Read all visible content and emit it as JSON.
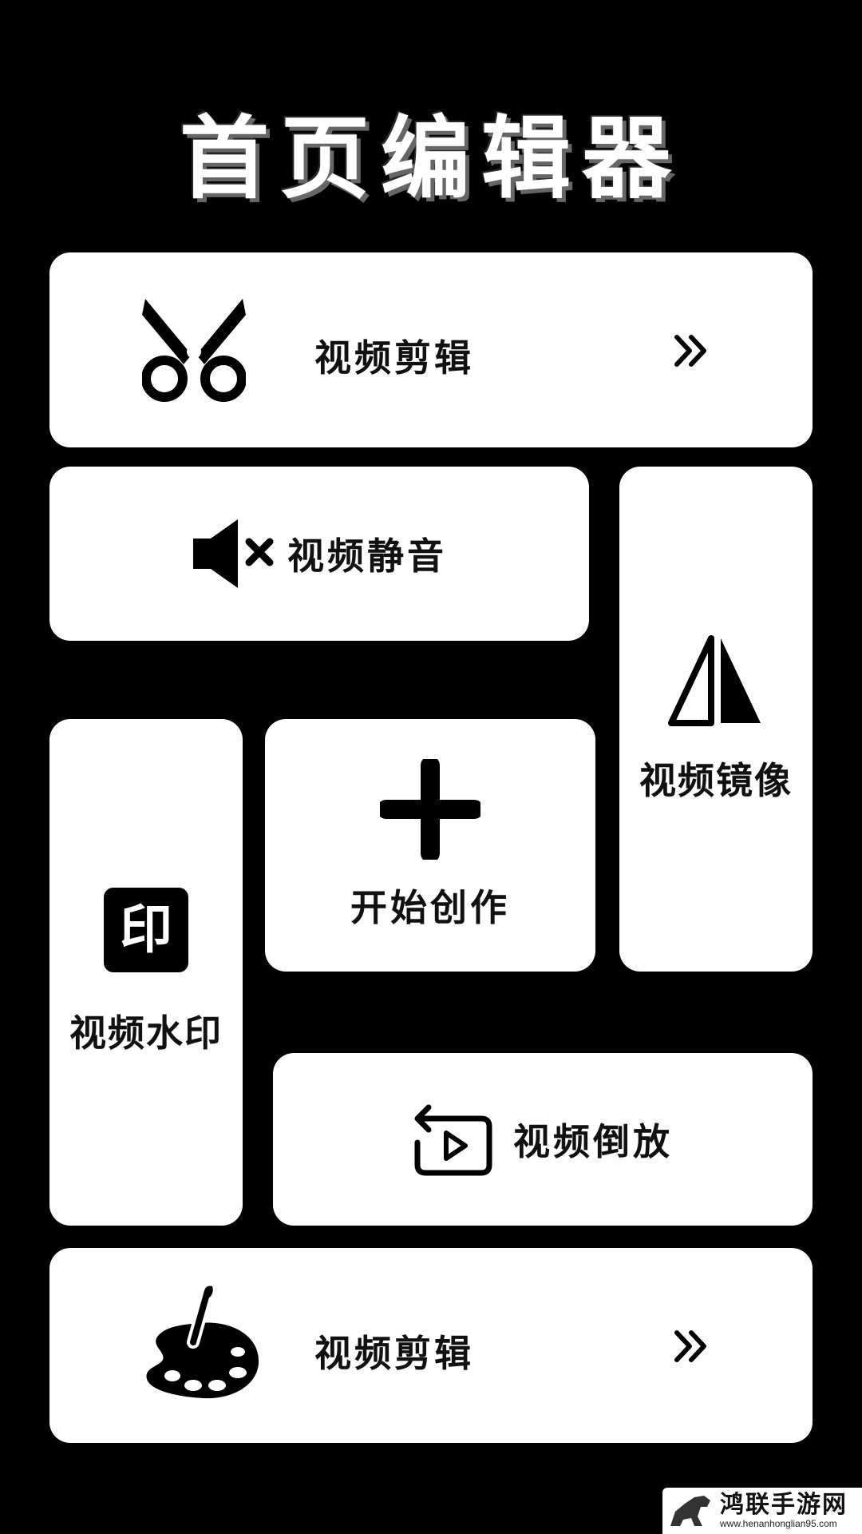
{
  "header": {
    "title": "首页编辑器"
  },
  "tiles": {
    "cut": {
      "label": "视频剪辑",
      "icon": "scissors-icon",
      "action_icon": "double-chevron-right-icon"
    },
    "mute": {
      "label": "视频静音",
      "icon": "speaker-mute-icon"
    },
    "mirror": {
      "label": "视频镜像",
      "icon": "mirror-icon"
    },
    "create": {
      "label": "开始创作",
      "icon": "plus-icon"
    },
    "watermark": {
      "label": "视频水印",
      "icon": "stamp-icon",
      "icon_text": "印"
    },
    "reverse": {
      "label": "视频倒放",
      "icon": "reverse-play-icon"
    },
    "edit2": {
      "label": "视频剪辑",
      "icon": "palette-icon",
      "action_icon": "double-chevron-right-icon"
    }
  },
  "site_watermark": {
    "main": "鸿联手游网",
    "sub": "www.henanhonglian95.com"
  },
  "colors": {
    "background": "#000000",
    "card": "#ffffff",
    "text": "#111111"
  }
}
